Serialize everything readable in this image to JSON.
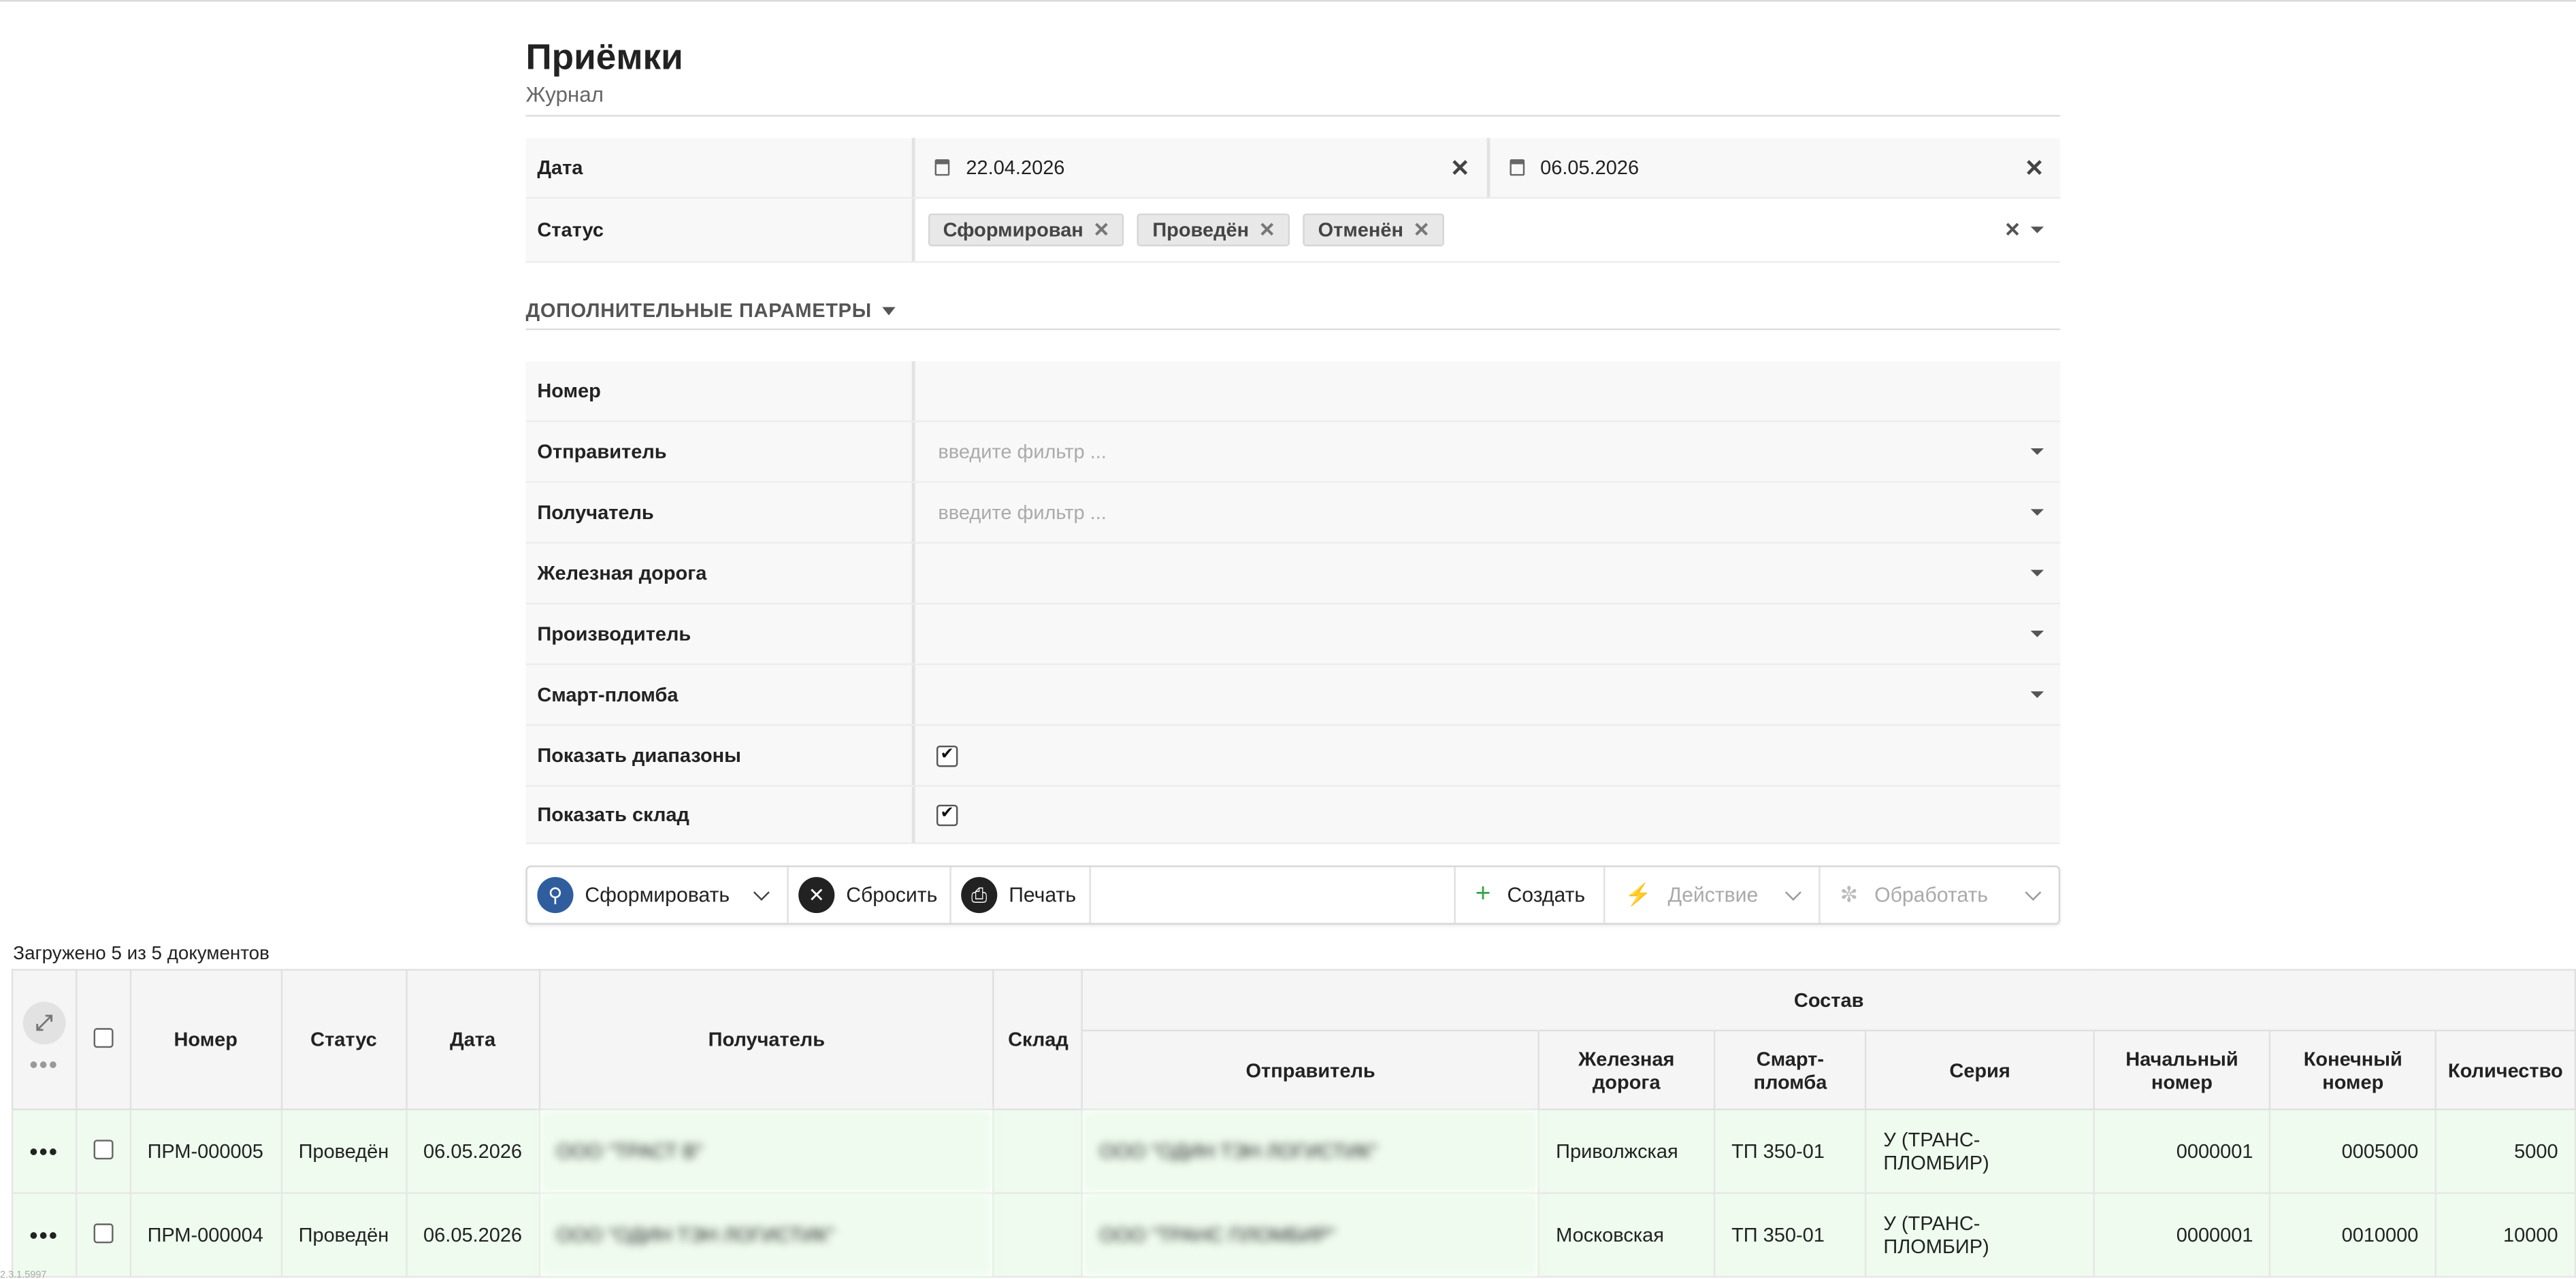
{
  "page": {
    "title": "Приёмки",
    "subtitle": "Журнал"
  },
  "filters": {
    "date_label": "Дата",
    "date_from": "22.04.2026",
    "date_to": "06.05.2026",
    "clear_glyph": "✕",
    "status_label": "Статус",
    "status_tags": [
      "Сформирован",
      "Проведён",
      "Отменён"
    ],
    "advanced_label": "ДОПОЛНИТЕЛЬНЫЕ ПАРАМЕТРЫ",
    "number_label": "Номер",
    "sender_label": "Отправитель",
    "sender_placeholder": "введите фильтр ...",
    "receiver_label": "Получатель",
    "receiver_placeholder": "введите фильтр ...",
    "railway_label": "Железная дорога",
    "manufacturer_label": "Производитель",
    "smartseal_label": "Смарт-пломба",
    "show_ranges_label": "Показать диапазоны",
    "show_ranges_checked": true,
    "show_warehouse_label": "Показать склад",
    "show_warehouse_checked": true
  },
  "toolbar": {
    "generate_label": "Сформировать",
    "reset_label": "Сбросить",
    "print_label": "Печать",
    "create_label": "Создать",
    "action_label": "Действие",
    "process_label": "Обработать",
    "colors": {
      "generate": "#2f5d9e",
      "reset": "#222222",
      "print": "#222222",
      "create": "#3aa04a"
    }
  },
  "grid": {
    "loaded_text": "Загружено 5 из 5 документов",
    "headers": {
      "number": "Номер",
      "status": "Статус",
      "date": "Дата",
      "receiver": "Получатель",
      "warehouse": "Склад",
      "composition": "Состав",
      "sender": "Отправитель",
      "railway": "Железная дорога",
      "smartseal": "Смарт-пломба",
      "series": "Серия",
      "start_no": "Начальный номер",
      "end_no": "Конечный номер",
      "qty": "Количество"
    },
    "rows": [
      {
        "number": "ПРМ-000005",
        "status": "Проведён",
        "date": "06.05.2026",
        "receiver": "ООО \"ТРАСТ В\"",
        "warehouse": "",
        "sender": "ООО \"ОДИН ТЭН ЛОГИСТИК\"",
        "railway": "Приволжская",
        "smartseal": "ТП 350-01",
        "series": "У (ТРАНС-ПЛОМБИР)",
        "start_no": "0000001",
        "end_no": "0005000",
        "qty": "5000"
      },
      {
        "number": "ПРМ-000004",
        "status": "Проведён",
        "date": "06.05.2026",
        "receiver": "ООО \"ОДИН ТЭН ЛОГИСТИК\"",
        "warehouse": "",
        "sender": "ООО \"ТРАНС ПЛОМБИР\"",
        "railway": "Московская",
        "smartseal": "ТП 350-01",
        "series": "У (ТРАНС-ПЛОМБИР)",
        "start_no": "0000001",
        "end_no": "0010000",
        "qty": "10000"
      }
    ],
    "row_bg": "#eefbee",
    "link_color": "#2d6fb3"
  },
  "footer": {
    "version": "2.3.1.5997"
  }
}
